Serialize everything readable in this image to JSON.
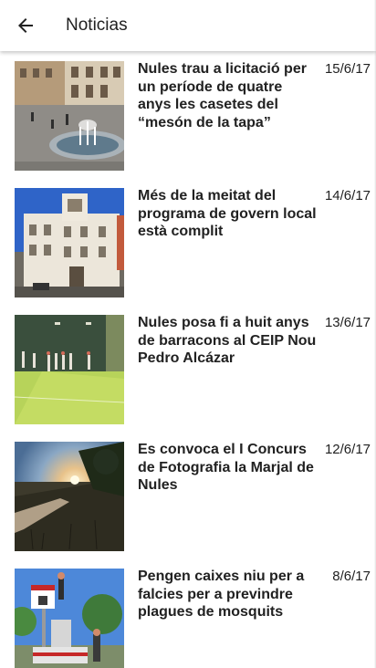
{
  "appbar": {
    "back_icon": "arrow-left-icon",
    "title": "Noticias"
  },
  "news": [
    {
      "title": "Nules trau a licitació per un període de quatre anys les casetes del “mesón de la tapa”",
      "date": "15/6/17"
    },
    {
      "title": "Més de la meitat del programa de govern local està complit",
      "date": "14/6/17"
    },
    {
      "title": "Nules posa fi a huit anys de barracons al CEIP Nou Pedro Alcázar",
      "date": "13/6/17"
    },
    {
      "title": "Es convoca el I Concurs de Fotografia la Marjal de Nules",
      "date": "12/6/17"
    },
    {
      "title": "Pengen caixes niu per a falcies per a previndre plagues de mosquits",
      "date": "8/6/17"
    }
  ]
}
